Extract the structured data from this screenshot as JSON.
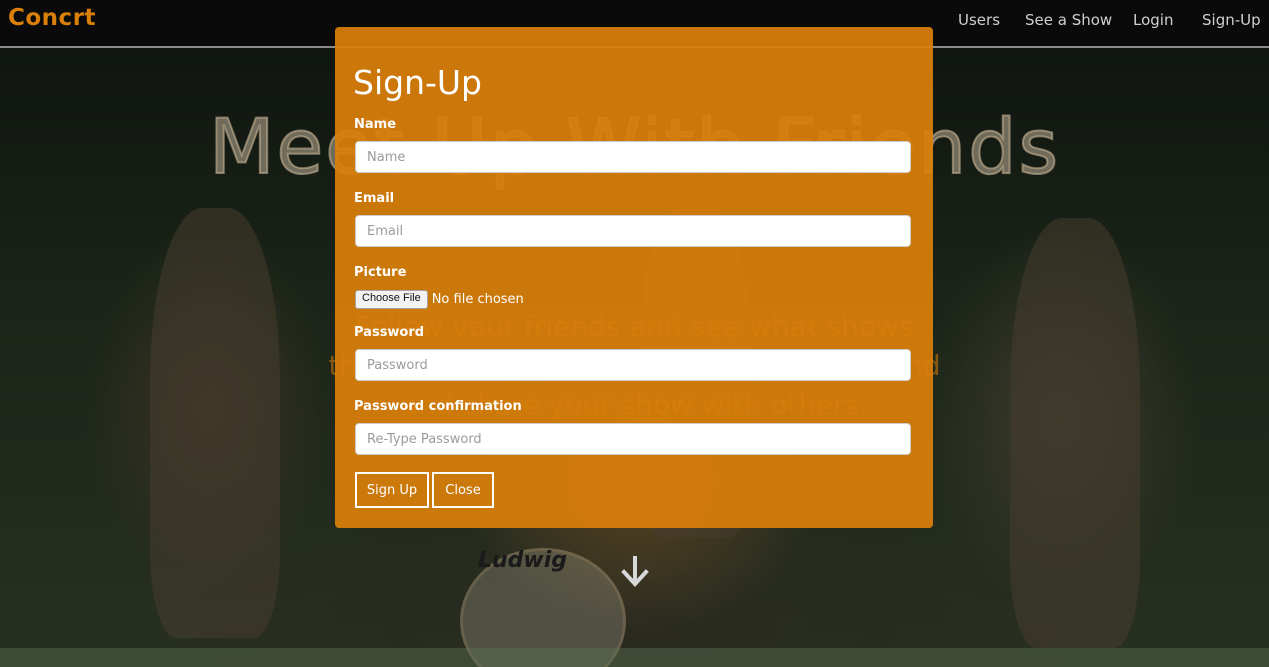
{
  "navbar": {
    "brand": "Concrt",
    "links": [
      "Users",
      "See a Show",
      "Login",
      "Sign-Up"
    ]
  },
  "hero": {
    "title": "Meet Up With Friends",
    "subtitle_lines": [
      "Follow your friends and see what shows",
      "they're going to, or share a show you found",
      "and share your show with others."
    ],
    "drum_logo": "Ludwig"
  },
  "modal": {
    "title": "Sign-Up",
    "fields": {
      "name": {
        "label": "Name",
        "placeholder": "Name",
        "value": ""
      },
      "email": {
        "label": "Email",
        "placeholder": "Email",
        "value": ""
      },
      "picture": {
        "label": "Picture",
        "button": "Choose File",
        "status": "No file chosen"
      },
      "password": {
        "label": "Password",
        "placeholder": "Password",
        "value": ""
      },
      "password_confirmation": {
        "label": "Password confirmation",
        "placeholder": "Re-Type Password",
        "value": ""
      }
    },
    "buttons": {
      "submit": "Sign Up",
      "close": "Close"
    }
  },
  "colors": {
    "accent": "#d97f0a",
    "navbar_bg": "#0a0a0a",
    "nav_text": "#cfcfcf"
  },
  "icons": {
    "scroll_down": "down-arrow-icon"
  }
}
